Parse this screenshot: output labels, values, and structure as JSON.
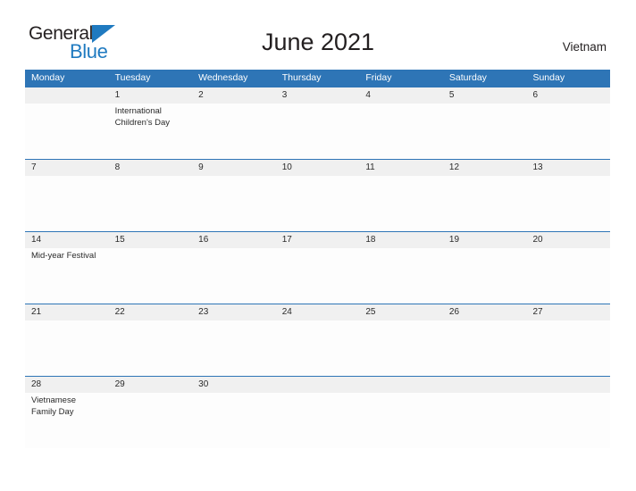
{
  "logo": {
    "word_one": "General",
    "word_two": "Blue",
    "triangle_icon": "blue-triangle-icon",
    "brand_blue": "#1f7ac0"
  },
  "header": {
    "title": "June 2021",
    "region": "Vietnam"
  },
  "theme": {
    "header_blue": "#2e75b6",
    "date_band_gray": "#f0f0f0",
    "text_dark": "#231f20"
  },
  "calendar": {
    "day_headers": [
      "Monday",
      "Tuesday",
      "Wednesday",
      "Thursday",
      "Friday",
      "Saturday",
      "Sunday"
    ],
    "weeks": [
      {
        "dates": [
          "",
          "1",
          "2",
          "3",
          "4",
          "5",
          "6"
        ],
        "events": [
          "",
          "International Children's Day",
          "",
          "",
          "",
          "",
          ""
        ]
      },
      {
        "dates": [
          "7",
          "8",
          "9",
          "10",
          "11",
          "12",
          "13"
        ],
        "events": [
          "",
          "",
          "",
          "",
          "",
          "",
          ""
        ]
      },
      {
        "dates": [
          "14",
          "15",
          "16",
          "17",
          "18",
          "19",
          "20"
        ],
        "events": [
          "Mid-year Festival",
          "",
          "",
          "",
          "",
          "",
          ""
        ]
      },
      {
        "dates": [
          "21",
          "22",
          "23",
          "24",
          "25",
          "26",
          "27"
        ],
        "events": [
          "",
          "",
          "",
          "",
          "",
          "",
          ""
        ]
      },
      {
        "dates": [
          "28",
          "29",
          "30",
          "",
          "",
          "",
          ""
        ],
        "events": [
          "Vietnamese Family Day",
          "",
          "",
          "",
          "",
          "",
          ""
        ]
      }
    ]
  }
}
